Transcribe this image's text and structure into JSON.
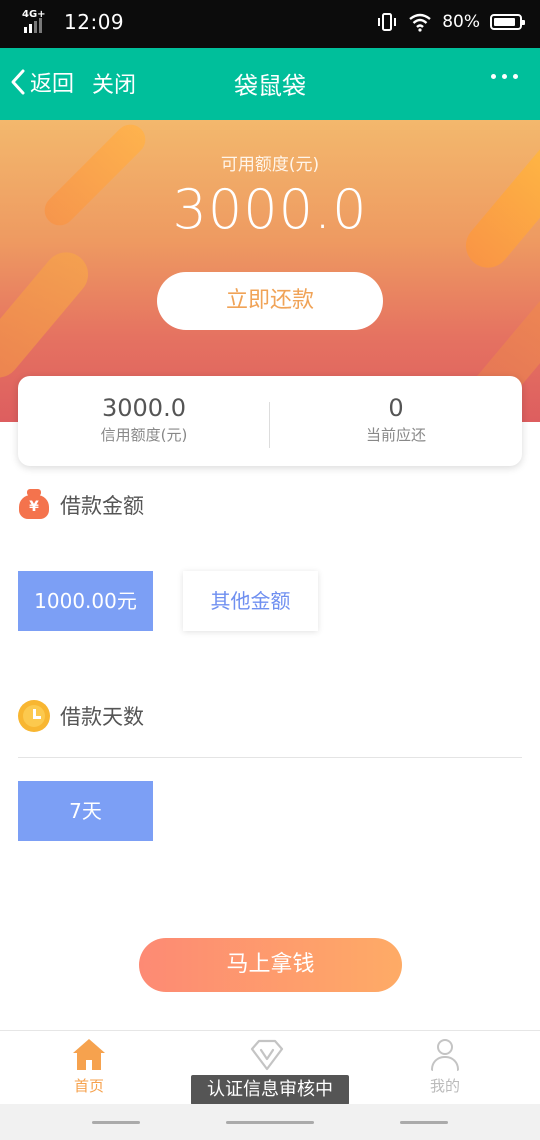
{
  "status_bar": {
    "network": "4G+",
    "time": "12:09",
    "battery": "80%"
  },
  "nav": {
    "back_label": "返回",
    "close_label": "关闭",
    "title": "袋鼠袋"
  },
  "hero": {
    "label": "可用额度(元)",
    "amount": "3000.0",
    "repay_button": "立即还款"
  },
  "summary": [
    {
      "value": "3000.0",
      "label": "信用额度(元)"
    },
    {
      "value": "0",
      "label": "当前应还"
    }
  ],
  "loan_amount": {
    "title": "借款金额",
    "bag_symbol": "¥",
    "options": [
      {
        "label": "1000.00元",
        "selected": true
      },
      {
        "label": "其他金额",
        "selected": false
      }
    ]
  },
  "loan_days": {
    "title": "借款天数",
    "options": [
      {
        "label": "7天",
        "selected": true
      }
    ]
  },
  "cta_button": "马上拿钱",
  "tabs": [
    {
      "label": "首页",
      "icon": "home-icon",
      "active": true
    },
    {
      "label": "",
      "icon": "v-diamond-icon",
      "active": false
    },
    {
      "label": "我的",
      "icon": "user-icon",
      "active": false
    }
  ],
  "toast": "认证信息审核中",
  "colors": {
    "primary": "#00bf9b",
    "accent": "#f6a24e",
    "chip": "#7c9ff5",
    "cta_start": "#fd8a74",
    "cta_end": "#feab66"
  }
}
